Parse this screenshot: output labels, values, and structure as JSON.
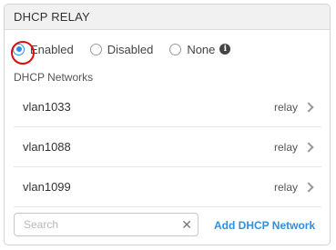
{
  "panel": {
    "title": "DHCP RELAY"
  },
  "radio": {
    "options": [
      {
        "label": "Enabled",
        "checked": true
      },
      {
        "label": "Disabled",
        "checked": false
      },
      {
        "label": "None",
        "checked": false
      }
    ]
  },
  "networks": {
    "heading": "DHCP Networks",
    "items": [
      {
        "name": "vlan1033",
        "mode": "relay"
      },
      {
        "name": "vlan1088",
        "mode": "relay"
      },
      {
        "name": "vlan1099",
        "mode": "relay"
      }
    ]
  },
  "search": {
    "placeholder": "Search",
    "value": ""
  },
  "actions": {
    "add_label": "Add DHCP Network"
  },
  "colors": {
    "accent": "#2f8fe0",
    "highlight": "#d81010"
  },
  "icons": {
    "info": "info-icon",
    "clear": "close-icon",
    "chevron": "chevron-right-icon"
  }
}
